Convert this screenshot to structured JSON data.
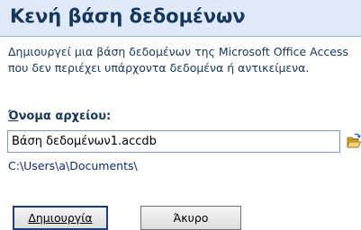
{
  "pane": {
    "title": "Κενή βάση δεδομένων",
    "description": "Δημιουργεί μια βάση δεδομένων της Microsoft Office Access που δεν περιέχει υπάρχοντα δεδομένα ή αντικείμενα.",
    "file_name_label_accel": "Ό",
    "file_name_label_rest": "νομα αρχείου:",
    "file_name_value": "Βάση δεδομένων1.accdb",
    "save_path": "C:\\Users\\a\\Documents\\",
    "browse_icon": "folder-open-icon",
    "create_button_label": "Δημιουργία",
    "cancel_button_label": "Άκυρο"
  },
  "colors": {
    "header_background": "#dfe9f7",
    "title_text": "#17365d",
    "path_text": "#0a2a7a"
  }
}
